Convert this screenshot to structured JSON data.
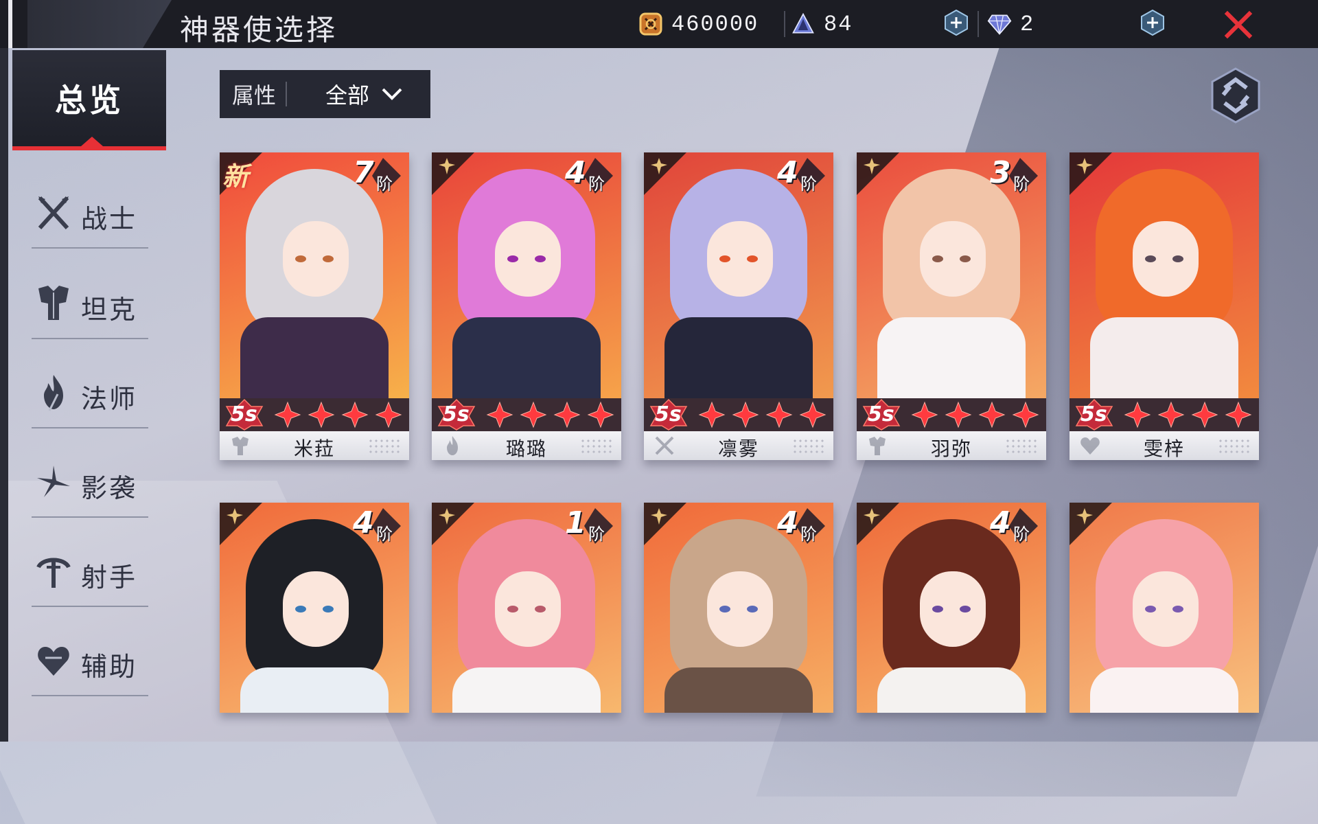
{
  "header": {
    "title": "神器使选择",
    "gold": "460000",
    "stamina": "84",
    "diamonds": "2"
  },
  "sidebar": {
    "overview": "总览",
    "items": [
      {
        "label": "战士",
        "icon": "crossed-swords-icon"
      },
      {
        "label": "坦克",
        "icon": "armor-icon"
      },
      {
        "label": "法师",
        "icon": "flame-staff-icon"
      },
      {
        "label": "影袭",
        "icon": "shuriken-icon"
      },
      {
        "label": "射手",
        "icon": "bow-icon"
      },
      {
        "label": "辅助",
        "icon": "heart-icon"
      }
    ]
  },
  "filter": {
    "label": "属性",
    "value": "全部"
  },
  "cards": [
    {
      "name": "米菈",
      "tier": "7",
      "tier_unit": "阶",
      "rank": "5s",
      "stars": 4,
      "is_new": true,
      "new_label": "新",
      "class_icon": "armor-icon",
      "hair": "#d9d6dc",
      "outfit": "#3e2c4a",
      "eye": "#c06a3a",
      "bg": [
        "#f04a3c",
        "#f7b14a"
      ]
    },
    {
      "name": "璐璐",
      "tier": "4",
      "tier_unit": "阶",
      "rank": "5s",
      "stars": 4,
      "is_new": false,
      "class_icon": "flame-staff-icon",
      "hair": "#e07ad8",
      "outfit": "#2b2f4a",
      "eye": "#9a2aa8",
      "bg": [
        "#e8433a",
        "#f6a34a"
      ]
    },
    {
      "name": "凛雾",
      "tier": "4",
      "tier_unit": "阶",
      "rank": "5s",
      "stars": 4,
      "is_new": false,
      "class_icon": "crossed-swords-icon",
      "hair": "#b7b2e6",
      "outfit": "#25263a",
      "eye": "#e2542a",
      "bg": [
        "#e0443a",
        "#f19a4e"
      ]
    },
    {
      "name": "羽弥",
      "tier": "3",
      "tier_unit": "阶",
      "rank": "5s",
      "stars": 4,
      "is_new": false,
      "class_icon": "armor-icon",
      "hair": "#f2c4a8",
      "outfit": "#f7f3f4",
      "eye": "#8a5a4a",
      "bg": [
        "#ea4d3e",
        "#f5a964"
      ]
    },
    {
      "name": "雯梓",
      "tier": "",
      "tier_unit": "",
      "rank": "5s",
      "stars": 4,
      "is_new": false,
      "class_icon": "heart-icon",
      "hair": "#f06a2a",
      "outfit": "#f4ecec",
      "eye": "#5a4a58",
      "bg": [
        "#e4383a",
        "#f28a3e"
      ]
    },
    {
      "name": "",
      "tier": "4",
      "tier_unit": "阶",
      "rank": "",
      "stars": 0,
      "is_new": false,
      "class_icon": "",
      "hair": "#1e2026",
      "outfit": "#e9eef4",
      "eye": "#3a7ab8",
      "bg": [
        "#f06a3a",
        "#f8b870"
      ]
    },
    {
      "name": "",
      "tier": "1",
      "tier_unit": "阶",
      "rank": "",
      "stars": 0,
      "is_new": false,
      "class_icon": "",
      "hair": "#f08a9c",
      "outfit": "#f6f4f4",
      "eye": "#b85a6a",
      "bg": [
        "#ef6a3e",
        "#f7b86e"
      ]
    },
    {
      "name": "",
      "tier": "4",
      "tier_unit": "阶",
      "rank": "",
      "stars": 0,
      "is_new": false,
      "class_icon": "",
      "hair": "#c9a68a",
      "outfit": "#6a5246",
      "eye": "#5a6ab8",
      "bg": [
        "#f06a3a",
        "#f6ae64"
      ]
    },
    {
      "name": "",
      "tier": "4",
      "tier_unit": "阶",
      "rank": "",
      "stars": 0,
      "is_new": false,
      "class_icon": "",
      "hair": "#6a2a1e",
      "outfit": "#f4f2f0",
      "eye": "#6a4aa0",
      "bg": [
        "#ee6a3a",
        "#f7b46a"
      ]
    },
    {
      "name": "",
      "tier": "",
      "tier_unit": "",
      "rank": "",
      "stars": 0,
      "is_new": false,
      "class_icon": "",
      "hair": "#f6a2a8",
      "outfit": "#faf2f2",
      "eye": "#7a5ab0",
      "bg": [
        "#f07a4a",
        "#f8c07e"
      ]
    }
  ],
  "colors": {
    "accent_red": "#e63036",
    "topbar": "#1c1d24",
    "panel": "#262833"
  }
}
